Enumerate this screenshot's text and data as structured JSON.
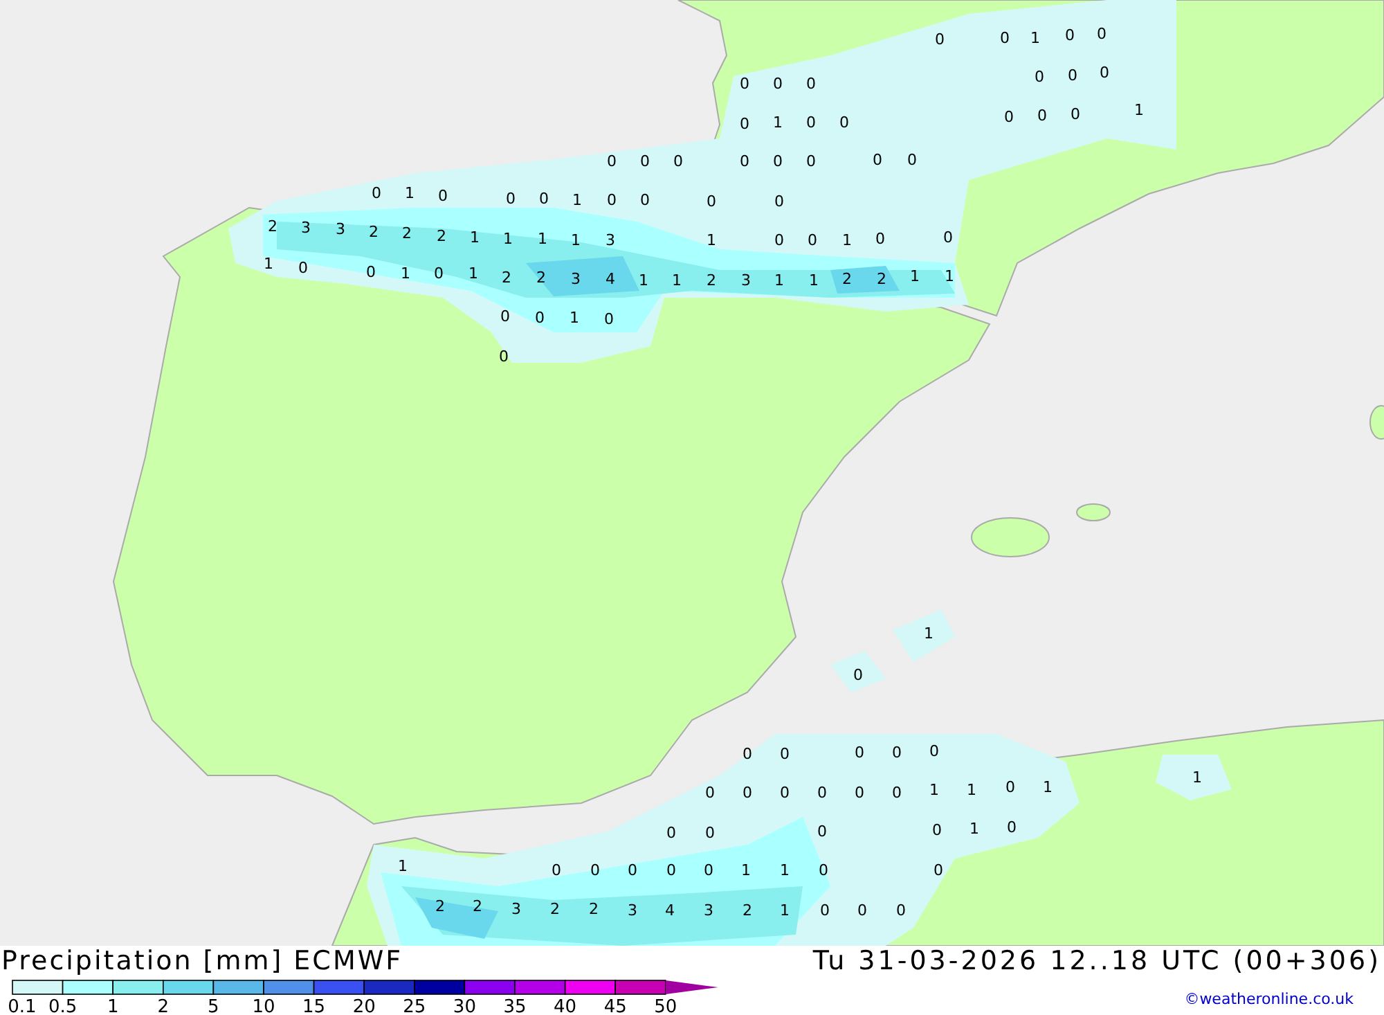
{
  "map": {
    "values": [
      "0",
      "0",
      "1",
      "0",
      "0",
      "0",
      "0",
      "0",
      "0",
      "0",
      "0",
      "0",
      "1",
      "0",
      "0",
      "0",
      "0",
      "0",
      "1",
      "0",
      "0",
      "0",
      "0",
      "0",
      "0",
      "0",
      "0",
      "0",
      "1",
      "0",
      "0",
      "0",
      "1",
      "0",
      "0",
      "0",
      "0",
      "2",
      "3",
      "3",
      "2",
      "2",
      "2",
      "1",
      "1",
      "1",
      "1",
      "3",
      "1",
      "0",
      "0",
      "1",
      "0",
      "0",
      "1",
      "0",
      "0",
      "1",
      "0",
      "1",
      "2",
      "2",
      "3",
      "4",
      "1",
      "1",
      "2",
      "3",
      "1",
      "1",
      "2",
      "2",
      "1",
      "1",
      "0",
      "0",
      "1",
      "0",
      "0",
      "1",
      "0",
      "0",
      "0",
      "0",
      "0",
      "0",
      "0",
      "0",
      "0",
      "0",
      "0",
      "0",
      "1",
      "1",
      "0",
      "1",
      "1",
      "0",
      "0",
      "0",
      "0",
      "1",
      "0",
      "1",
      "0",
      "0",
      "0",
      "0",
      "0",
      "1",
      "1",
      "0",
      "0",
      "2",
      "2",
      "3",
      "2",
      "2",
      "3",
      "4",
      "3",
      "2",
      "1",
      "0",
      "0",
      "0"
    ]
  },
  "footer": {
    "title": "Precipitation [mm] ECMWF",
    "valid_time": "Tu 31-03-2026 12..18 UTC (00+306)",
    "credit": "©weatheronline.co.uk"
  },
  "legend": {
    "swatches": [
      {
        "color": "#d4f8f8"
      },
      {
        "color": "#aaffff"
      },
      {
        "color": "#88eeee"
      },
      {
        "color": "#6ad8ec"
      },
      {
        "color": "#5ab8e8"
      },
      {
        "color": "#5090e8"
      },
      {
        "color": "#3a50f0"
      },
      {
        "color": "#1a2ac0"
      },
      {
        "color": "#0000a0"
      },
      {
        "color": "#8c00f0"
      },
      {
        "color": "#b400e8"
      },
      {
        "color": "#ee00f0"
      },
      {
        "color": "#c800b4"
      },
      {
        "kind": "arrow",
        "color": "#a000a0"
      }
    ],
    "labels": [
      "0.1",
      "0.5",
      "1",
      "2",
      "5",
      "10",
      "15",
      "20",
      "25",
      "30",
      "35",
      "40",
      "45",
      "50"
    ]
  }
}
